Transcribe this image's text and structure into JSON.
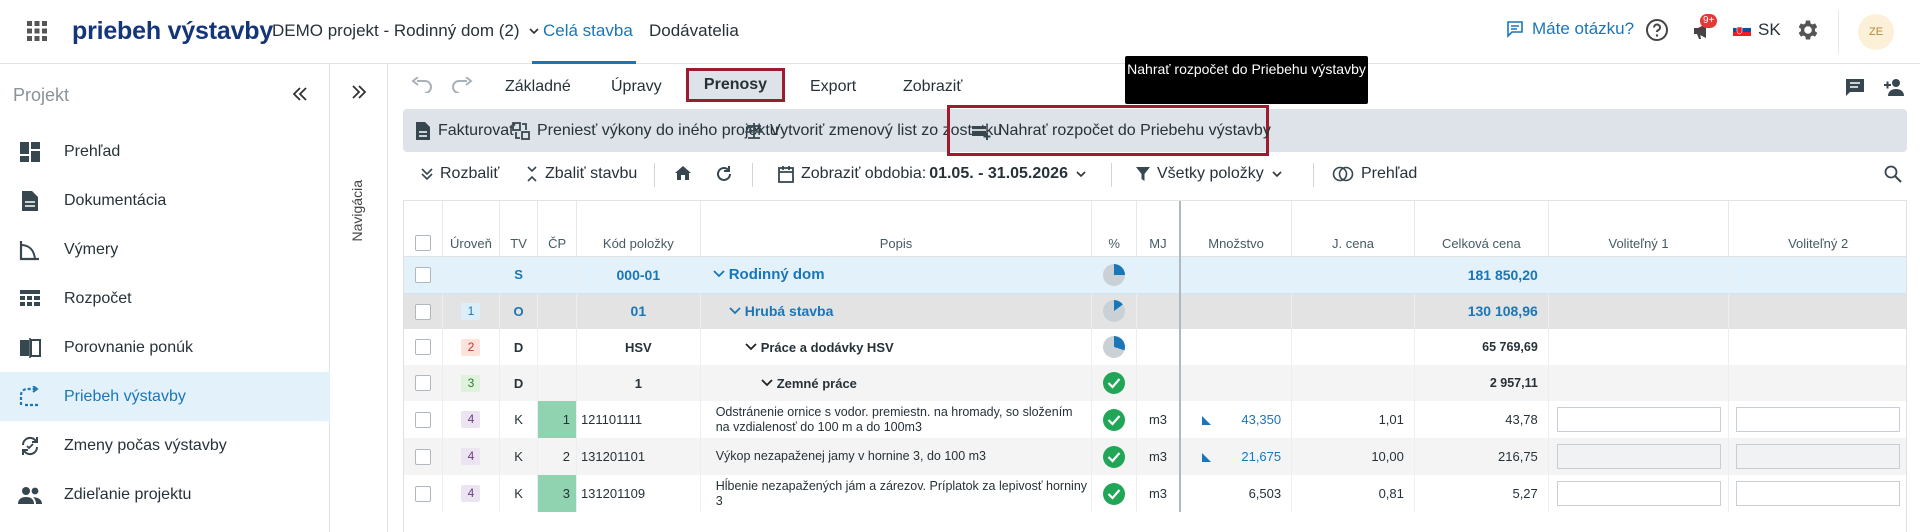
{
  "app": {
    "brand": "priebeh výstavby",
    "project": "DEMO projekt - Rodinný dom (2)",
    "tabs": [
      "Celá stavba",
      "Dodávatelia"
    ],
    "help": "Máte otázku?",
    "notif_badge": "9+",
    "lang": "SK",
    "avatar": "ZE"
  },
  "sidebar": {
    "title": "Projekt",
    "items": [
      {
        "label": "Prehľad",
        "icon": "dashboard-icon"
      },
      {
        "label": "Dokumentácia",
        "icon": "document-icon"
      },
      {
        "label": "Výmery",
        "icon": "measure-icon"
      },
      {
        "label": "Rozpočet",
        "icon": "budget-icon"
      },
      {
        "label": "Porovnanie ponúk",
        "icon": "compare-icon"
      },
      {
        "label": "Priebeh výstavby",
        "icon": "progress-icon",
        "active": true
      },
      {
        "label": "Zmeny počas výstavby",
        "icon": "changes-icon"
      },
      {
        "label": "Zdieľanie projektu",
        "icon": "share-icon"
      }
    ]
  },
  "nav": {
    "label": "Navigácia"
  },
  "ribbon": {
    "tabs": [
      "Základné",
      "Úpravy",
      "Prenosy",
      "Export",
      "Zobraziť"
    ],
    "tooltip": "Nahrať rozpočet do Priebehu výstavby",
    "buttons": [
      "Fakturovať",
      "Preniesť výkony do iného projektu",
      "Vytvoriť zmenový list zo zostatku",
      "Nahrať rozpočet do Priebehu výstavby"
    ]
  },
  "toolbar": {
    "expand": "Rozbaliť",
    "collapse": "Zbaliť stavbu",
    "period_label": "Zobraziť obdobia:",
    "period_value": "01.05. - 31.05.2026",
    "filter": "Všetky položky",
    "overview": "Prehľad"
  },
  "table": {
    "columns": [
      "Úroveň",
      "TV",
      "ČP",
      "Kód položky",
      "Popis",
      "%",
      "MJ",
      "Množstvo",
      "J. cena",
      "Celková cena",
      "Voliteľný 1",
      "Voliteľný 2"
    ],
    "rows": [
      {
        "level": "",
        "tv": "S",
        "cp": "",
        "code": "000-01",
        "desc": "Rodinný dom",
        "pct": 0.25,
        "mj": "",
        "qty": "",
        "unit": "",
        "total": "181 850,20"
      },
      {
        "level": "1",
        "tv": "O",
        "cp": "",
        "code": "01",
        "desc": "Hrubá stavba",
        "pct": 0.15,
        "mj": "",
        "qty": "",
        "unit": "",
        "total": "130 108,96"
      },
      {
        "level": "2",
        "tv": "D",
        "cp": "",
        "code": "HSV",
        "desc": "Práce a dodávky HSV",
        "pct": 0.3,
        "mj": "",
        "qty": "",
        "unit": "",
        "total": "65 769,69"
      },
      {
        "level": "3",
        "tv": "D",
        "cp": "",
        "code": "1",
        "desc": "Zemné práce",
        "pct": 1,
        "mj": "",
        "qty": "",
        "unit": "",
        "total": "2 957,11"
      },
      {
        "level": "4",
        "tv": "K",
        "cp": "1",
        "code": "121101111",
        "desc": "Odstránenie ornice s vodor. premiestn. na hromady, so složením na vzdialenosť do 100 m a do 100m3",
        "pct": 1,
        "mj": "m3",
        "qty": "43,350",
        "unit": "1,01",
        "total": "43,78"
      },
      {
        "level": "4",
        "tv": "K",
        "cp": "2",
        "code": "131201101",
        "desc": "Výkop nezapaženej jamy v hornine 3, do 100 m3",
        "pct": 1,
        "mj": "m3",
        "qty": "21,675",
        "unit": "10,00",
        "total": "216,75"
      },
      {
        "level": "4",
        "tv": "K",
        "cp": "3",
        "code": "131201109",
        "desc": "Hĺbenie nezapažených jám a zárezov. Príplatok za lepivosť horniny 3",
        "pct": 1,
        "mj": "m3",
        "qty": "6,503",
        "unit": "0,81",
        "total": "5,27"
      }
    ]
  },
  "colors": {
    "accent": "#1976b8",
    "brand": "#14357a",
    "highlight": "#9c1b2e",
    "ok": "#21a556",
    "cp": "#8fd3b0"
  }
}
